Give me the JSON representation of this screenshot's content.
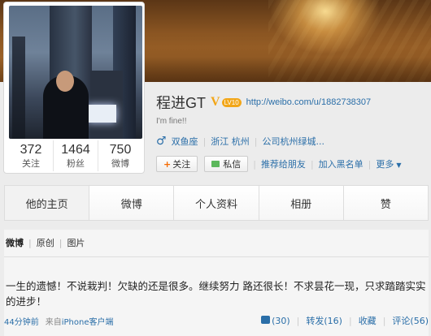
{
  "profile": {
    "name": "程进GT",
    "verified_mark": "V",
    "level": "LV10",
    "url": "http://weibo.com/u/1882738307",
    "bio": "I'm fine!!",
    "zodiac": "双鱼座",
    "province": "浙江",
    "city": "杭州",
    "company": "公司杭州绿城..."
  },
  "stats": [
    {
      "num": "372",
      "label": "关注"
    },
    {
      "num": "1464",
      "label": "粉丝"
    },
    {
      "num": "750",
      "label": "微博"
    }
  ],
  "actions": {
    "follow": "关注",
    "message": "私信",
    "recommend": "推荐给朋友",
    "blacklist": "加入黑名单",
    "more": "更多"
  },
  "tabs": [
    "他的主页",
    "微博",
    "个人资料",
    "相册",
    "赞"
  ],
  "subtabs": [
    "微博",
    "原创",
    "图片"
  ],
  "post": {
    "text": "一生的遗憾！不说栽判！欠缺的还是很多。继续努力 路还很长！不求昙花一现，只求踏踏实实的进步！",
    "time": "44分钟前",
    "source_prefix": "来自",
    "source": "iPhone客户端",
    "likes": "(30)",
    "reposts": "转发(16)",
    "favorite": "收藏",
    "comments": "评论(56)"
  },
  "colors": {
    "link": "#2a6ea8",
    "verified": "#f2a618",
    "follow_plus": "#f56a00"
  }
}
